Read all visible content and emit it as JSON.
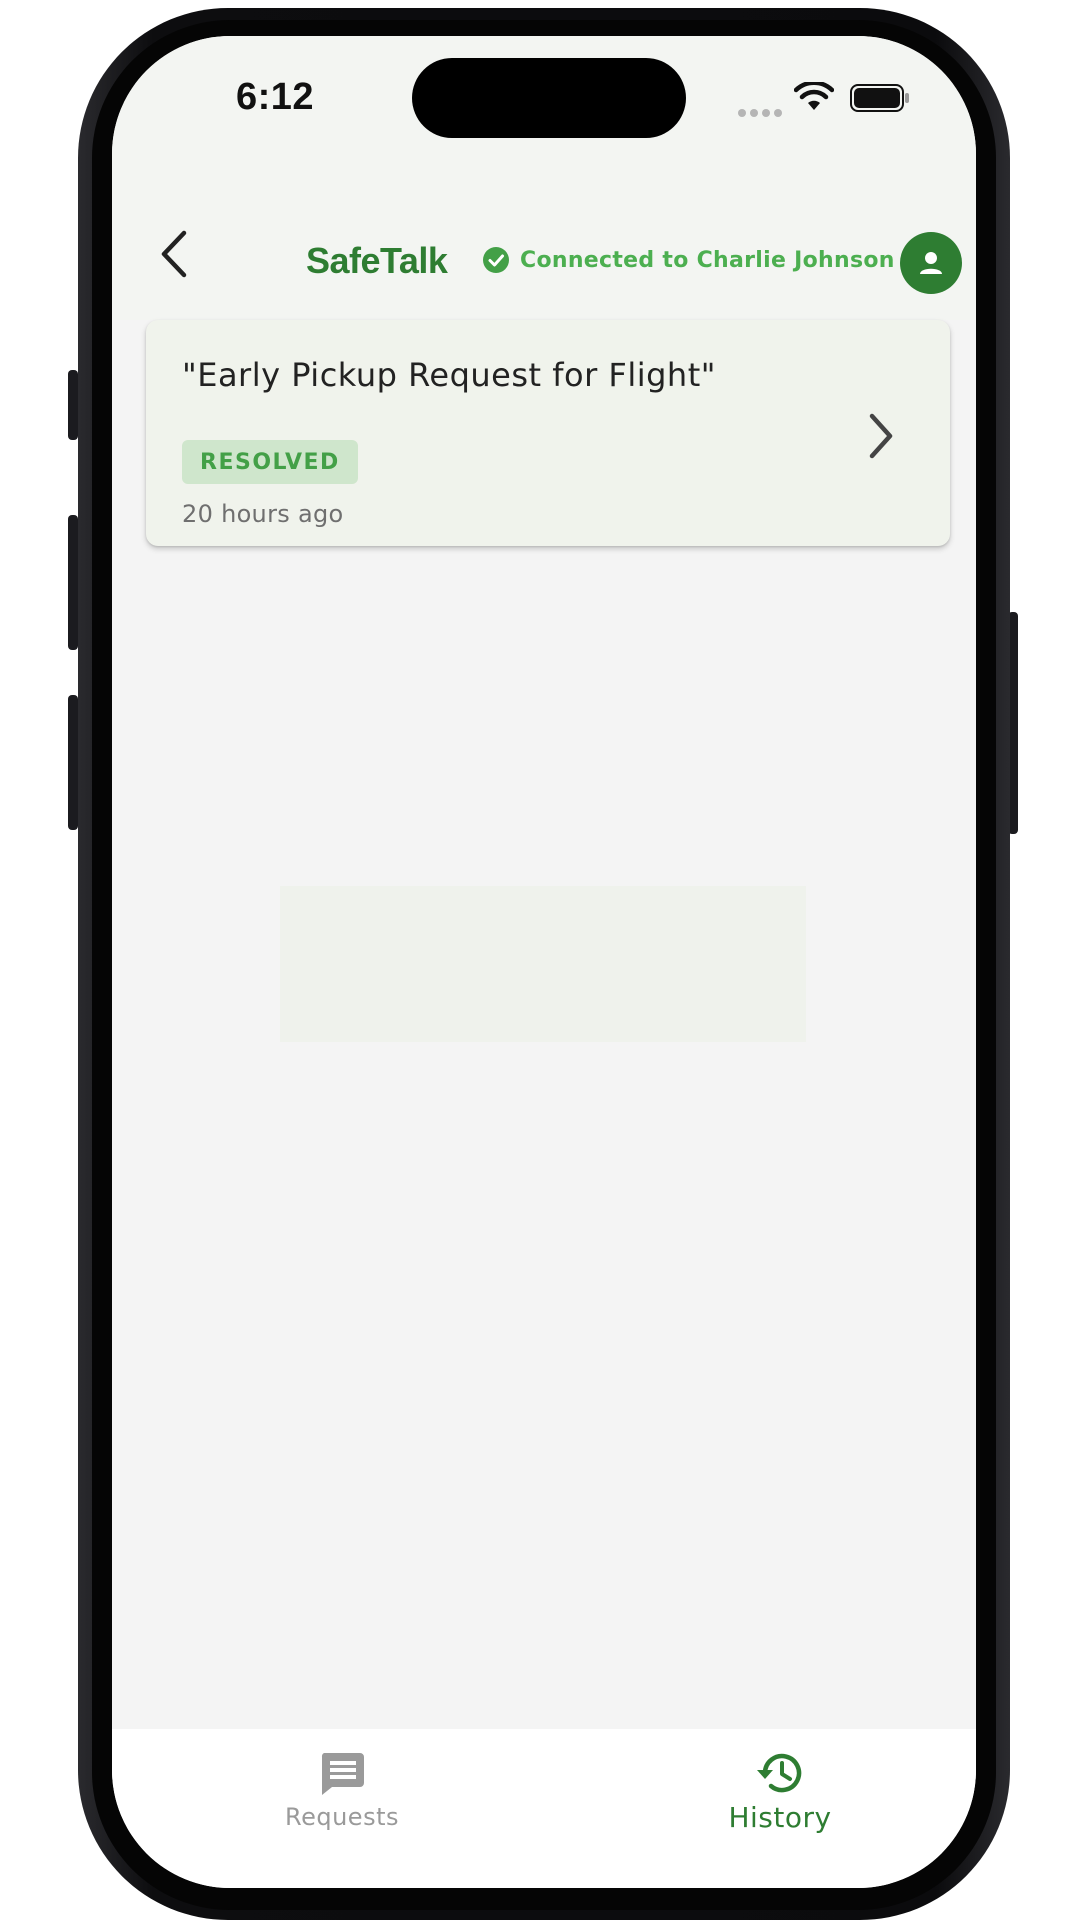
{
  "status_bar": {
    "time": "6:12"
  },
  "header": {
    "title": "SafeTalk",
    "connection_text": "Connected to Charlie Johnson",
    "icons": {
      "back": "chevron-left-icon",
      "connected": "check-circle-icon",
      "avatar": "person-icon"
    }
  },
  "request_card": {
    "title": "\"Early Pickup Request for Flight\"",
    "status": "RESOLVED",
    "time_ago": "20 hours ago",
    "icon": "chevron-right-icon"
  },
  "bottom_nav": {
    "items": [
      {
        "label": "Requests",
        "icon": "chat-icon",
        "active": false
      },
      {
        "label": "History",
        "icon": "history-icon",
        "active": true
      }
    ]
  },
  "colors": {
    "brand": "#2e7d32",
    "accent": "#4caf50",
    "badge_bg": "#cfe6cc",
    "inactive": "#9a9a9a",
    "background": "#f4f4f4"
  }
}
